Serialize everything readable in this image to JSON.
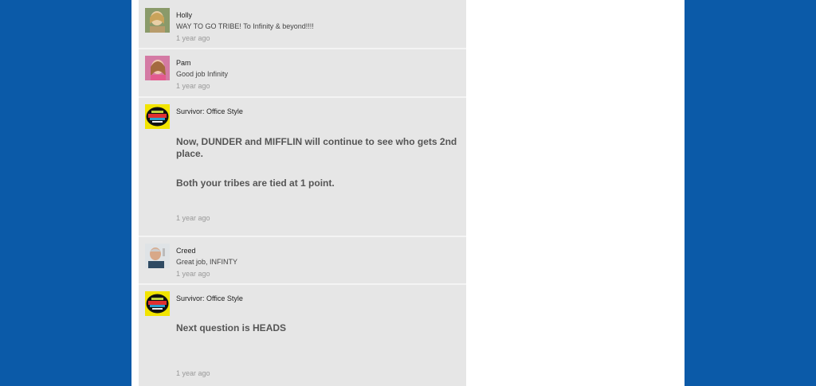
{
  "comments": [
    {
      "author": "Holly",
      "text": "WAY TO GO TRIBE!   To Infinity & beyond!!!!",
      "time": "1 year ago"
    },
    {
      "author": "Pam",
      "text": "Good job Infinity",
      "time": "1 year ago"
    },
    {
      "author": "Survivor: Office Style",
      "lines": [
        "Now, DUNDER and MIFFLIN will continue to see who gets 2nd place.",
        "Both your tribes are tied at 1 point."
      ],
      "time": "1 year ago"
    },
    {
      "author": "Creed",
      "text": "Great job, INFINTY",
      "time": "1 year ago"
    },
    {
      "author": "Survivor: Office Style",
      "lines": [
        "Next question is HEADS"
      ],
      "time": "1 year ago"
    }
  ]
}
